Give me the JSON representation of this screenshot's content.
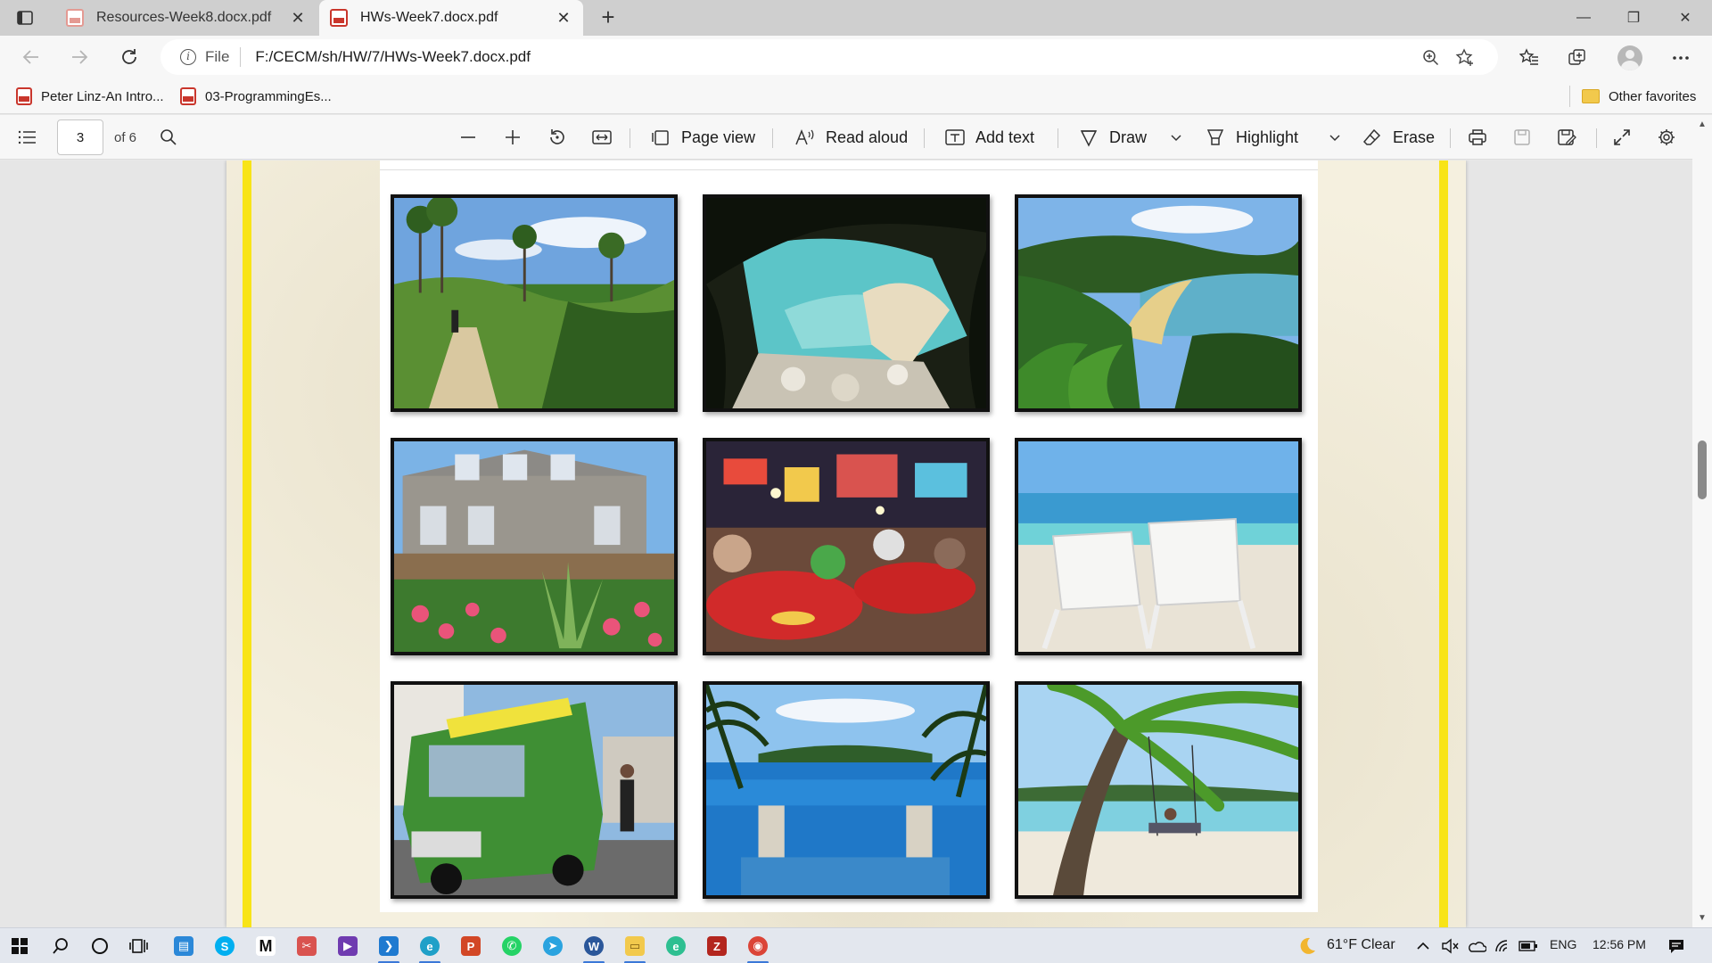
{
  "browser": {
    "tabs": [
      {
        "title": "Resources-Week8.docx.pdf",
        "active": false
      },
      {
        "title": "HWs-Week7.docx.pdf",
        "active": true
      }
    ],
    "tab_close_glyph": "✕",
    "new_tab_glyph": "+",
    "window_controls": {
      "minimize": "—",
      "restore": "❐",
      "close": "✕"
    }
  },
  "address_bar": {
    "scheme_label": "File",
    "url": "F:/CECM/sh/HW/7/HWs-Week7.docx.pdf"
  },
  "favorites": {
    "items": [
      {
        "label": "Peter Linz-An Intro...",
        "icon": "pdf-icon"
      },
      {
        "label": "03-ProgrammingEs...",
        "icon": "pdf-icon"
      }
    ],
    "other_favorites": "Other favorites"
  },
  "pdf_toolbar": {
    "current_page": "3",
    "page_count": "of 6",
    "page_view": "Page view",
    "read_aloud": "Read aloud",
    "add_text": "Add text",
    "draw": "Draw",
    "highlight": "Highlight",
    "erase": "Erase"
  },
  "document": {
    "photos": [
      {
        "subject": "jungle-trail-hiker"
      },
      {
        "subject": "hidden-cove-beach"
      },
      {
        "subject": "coastal-bay-fern-forest"
      },
      {
        "subject": "stone-house-flower-garden"
      },
      {
        "subject": "night-market-diners"
      },
      {
        "subject": "beach-lounge-chairs"
      },
      {
        "subject": "green-food-truck-street"
      },
      {
        "subject": "infinity-pool-palms"
      },
      {
        "subject": "palm-tree-beach-swing"
      }
    ]
  },
  "taskbar": {
    "weather": "61°F  Clear",
    "language": "ENG",
    "time": "12:56 PM"
  },
  "colors": {
    "page_border": "#f8e417",
    "paper": "#f5f0df",
    "accent": "#3b78d8"
  }
}
